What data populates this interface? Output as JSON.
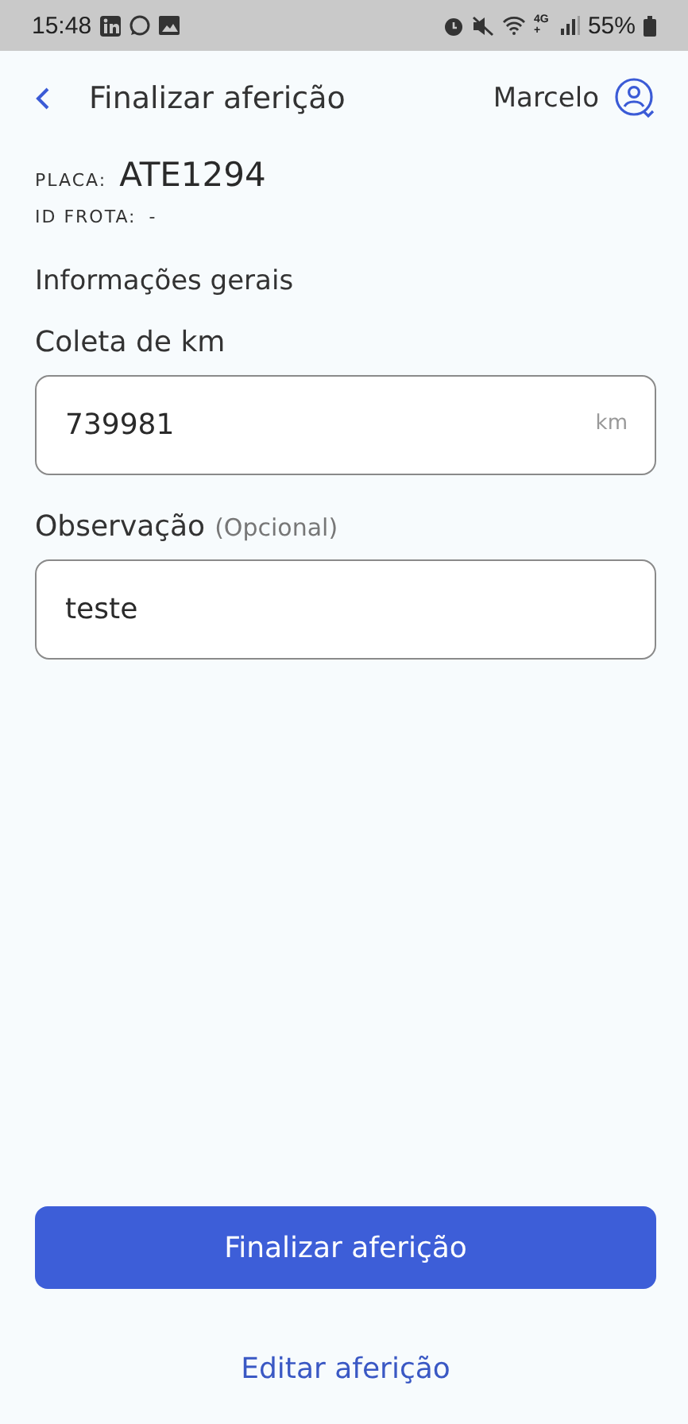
{
  "status_bar": {
    "time": "15:48",
    "network": "4G+",
    "battery": "55%"
  },
  "header": {
    "title": "Finalizar aferição",
    "user": "Marcelo"
  },
  "vehicle": {
    "plate_label": "PLACA:",
    "plate": "ATE1294",
    "fleet_id_label": "ID FROTA:",
    "fleet_id": "-"
  },
  "section_title": "Informações gerais",
  "fields": [
    {
      "label": "Coleta de km",
      "value": "739981",
      "unit": "km"
    },
    {
      "label": "Observação",
      "hint": "(Opcional)",
      "value": "teste"
    }
  ],
  "primary_button": "Finalizar aferição",
  "secondary_link": "Editar aferição"
}
